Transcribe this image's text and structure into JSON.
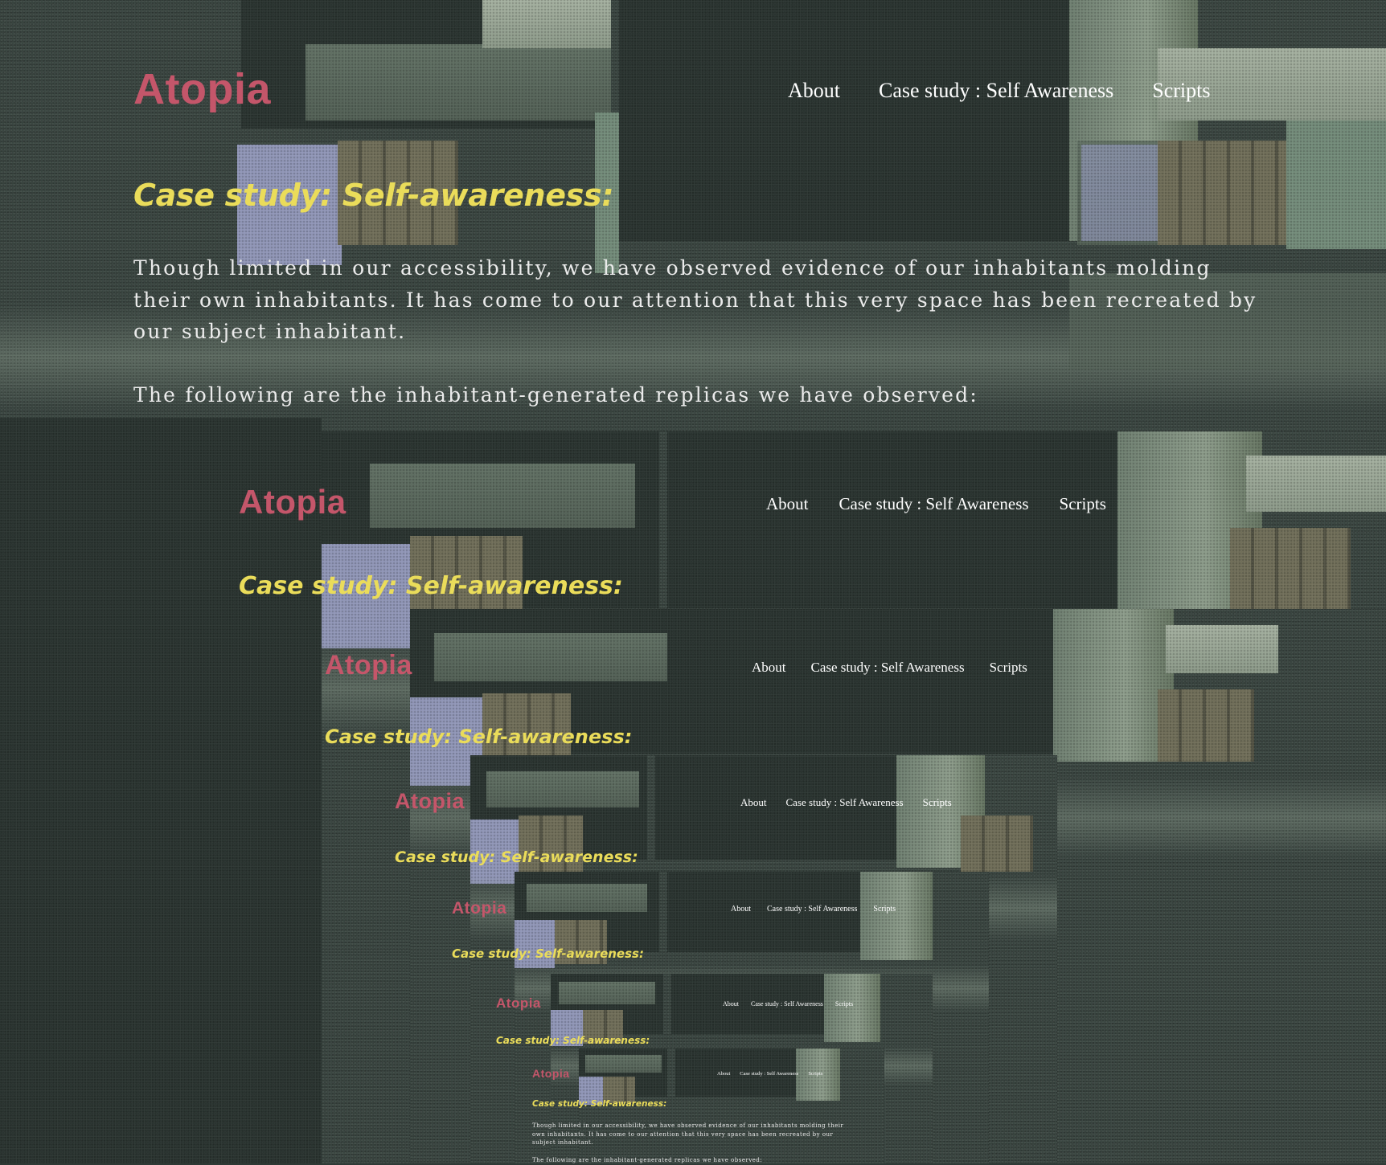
{
  "site": {
    "logo": "Atopia"
  },
  "nav": {
    "items": [
      {
        "label": "About"
      },
      {
        "label": "Case study : Self Awareness"
      },
      {
        "label": "Scripts"
      }
    ]
  },
  "main": {
    "heading": "Case study: Self-awareness:",
    "paragraphs": [
      "Though limited in our accessibility, we have observed evidence of our inhabitants molding their own inhabitants. It has come to our attention that this very space has been recreated by our subject inhabitant.",
      "The following are the inhabitant-generated replicas we have observed:"
    ]
  },
  "colors": {
    "logo": "#c4566a",
    "heading": "#eadc5a",
    "nav": "#ffffff",
    "body_text": "#ebebeb",
    "background": "#34403b"
  }
}
